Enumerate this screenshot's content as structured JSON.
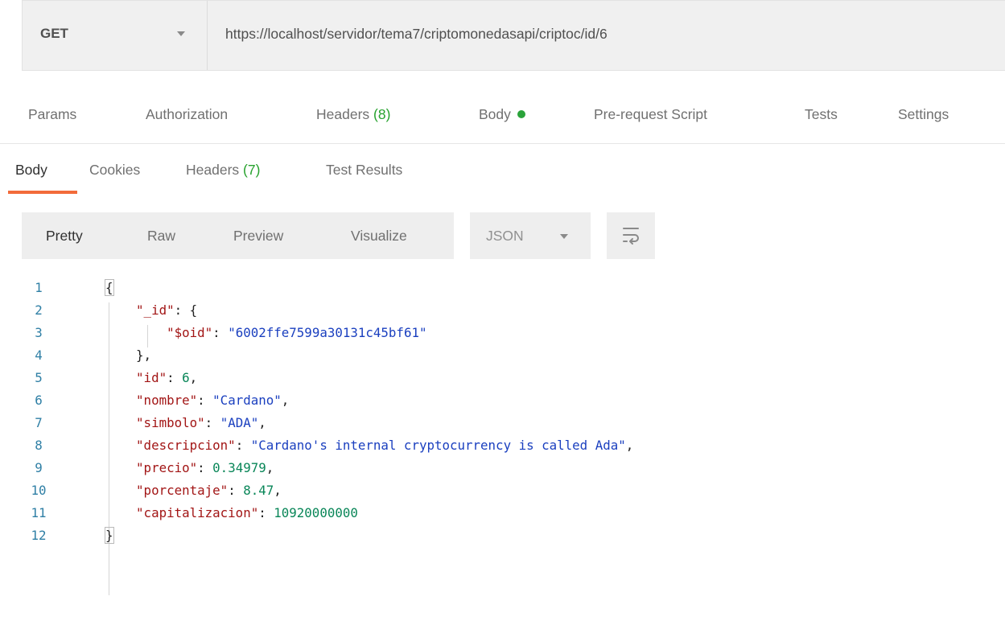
{
  "request": {
    "method": "GET",
    "url": "https://localhost/servidor/tema7/criptomonedasapi/criptoc/id/6"
  },
  "request_tabs": {
    "params": "Params",
    "authorization": "Authorization",
    "headers": "Headers",
    "headers_count": "(8)",
    "body": "Body",
    "pre_request": "Pre-request Script",
    "tests": "Tests",
    "settings": "Settings"
  },
  "response_tabs": {
    "body": "Body",
    "cookies": "Cookies",
    "headers": "Headers",
    "headers_count": "(7)",
    "test_results": "Test Results",
    "active": "Body",
    "accent_color": "#f26b3a"
  },
  "view": {
    "pretty": "Pretty",
    "raw": "Raw",
    "preview": "Preview",
    "visualize": "Visualize",
    "format": "JSON",
    "wrap_icon": "wrap-lines-icon"
  },
  "code": {
    "line_numbers": [
      "1",
      "2",
      "3",
      "4",
      "5",
      "6",
      "7",
      "8",
      "9",
      "10",
      "11",
      "12"
    ],
    "lines": [
      [
        {
          "t": "{",
          "c": "punct"
        }
      ],
      [
        {
          "t": "    "
        },
        {
          "t": "\"_id\"",
          "c": "key"
        },
        {
          "t": ": {",
          "c": "punct"
        }
      ],
      [
        {
          "t": "        "
        },
        {
          "t": "\"$oid\"",
          "c": "key"
        },
        {
          "t": ": ",
          "c": "punct"
        },
        {
          "t": "\"6002ffe7599a30131c45bf61\"",
          "c": "str"
        }
      ],
      [
        {
          "t": "    "
        },
        {
          "t": "},",
          "c": "punct"
        }
      ],
      [
        {
          "t": "    "
        },
        {
          "t": "\"id\"",
          "c": "key"
        },
        {
          "t": ": ",
          "c": "punct"
        },
        {
          "t": "6",
          "c": "num"
        },
        {
          "t": ",",
          "c": "punct"
        }
      ],
      [
        {
          "t": "    "
        },
        {
          "t": "\"nombre\"",
          "c": "key"
        },
        {
          "t": ": ",
          "c": "punct"
        },
        {
          "t": "\"Cardano\"",
          "c": "str"
        },
        {
          "t": ",",
          "c": "punct"
        }
      ],
      [
        {
          "t": "    "
        },
        {
          "t": "\"simbolo\"",
          "c": "key"
        },
        {
          "t": ": ",
          "c": "punct"
        },
        {
          "t": "\"ADA\"",
          "c": "str"
        },
        {
          "t": ",",
          "c": "punct"
        }
      ],
      [
        {
          "t": "    "
        },
        {
          "t": "\"descripcion\"",
          "c": "key"
        },
        {
          "t": ": ",
          "c": "punct"
        },
        {
          "t": "\"Cardano's internal cryptocurrency is called Ada\"",
          "c": "str"
        },
        {
          "t": ",",
          "c": "punct"
        }
      ],
      [
        {
          "t": "    "
        },
        {
          "t": "\"precio\"",
          "c": "key"
        },
        {
          "t": ": ",
          "c": "punct"
        },
        {
          "t": "0.34979",
          "c": "num"
        },
        {
          "t": ",",
          "c": "punct"
        }
      ],
      [
        {
          "t": "    "
        },
        {
          "t": "\"porcentaje\"",
          "c": "key"
        },
        {
          "t": ": ",
          "c": "punct"
        },
        {
          "t": "8.47",
          "c": "num"
        },
        {
          "t": ",",
          "c": "punct"
        }
      ],
      [
        {
          "t": "    "
        },
        {
          "t": "\"capitalizacion\"",
          "c": "key"
        },
        {
          "t": ": ",
          "c": "punct"
        },
        {
          "t": "10920000000",
          "c": "num"
        }
      ],
      [
        {
          "t": "}",
          "c": "punct"
        }
      ]
    ]
  }
}
